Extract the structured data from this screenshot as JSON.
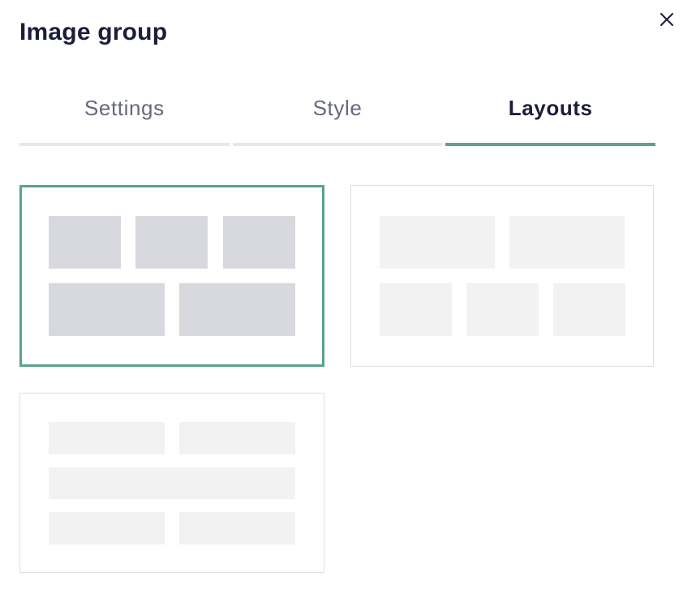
{
  "panel": {
    "title": "Image group"
  },
  "icons": {
    "close": "close-icon"
  },
  "tabs": [
    {
      "id": "settings",
      "label": "Settings",
      "active": false
    },
    {
      "id": "style",
      "label": "Style",
      "active": false
    },
    {
      "id": "layouts",
      "label": "Layouts",
      "active": true
    }
  ],
  "layouts": {
    "selected": "layout-1",
    "options": [
      {
        "id": "layout-1",
        "rows": [
          3,
          2
        ],
        "selected": true
      },
      {
        "id": "layout-2",
        "rows": [
          2,
          3
        ],
        "selected": false
      },
      {
        "id": "layout-3",
        "rows": [
          2,
          1,
          2
        ],
        "selected": false
      }
    ]
  },
  "colors": {
    "accent": "#5ba38a",
    "title": "#1b1e3a",
    "tab_inactive": "#646a7c",
    "tab_underline": "#e7e8ec",
    "placeholder_selected": "#d8d9de",
    "placeholder": "#f2f2f3"
  }
}
